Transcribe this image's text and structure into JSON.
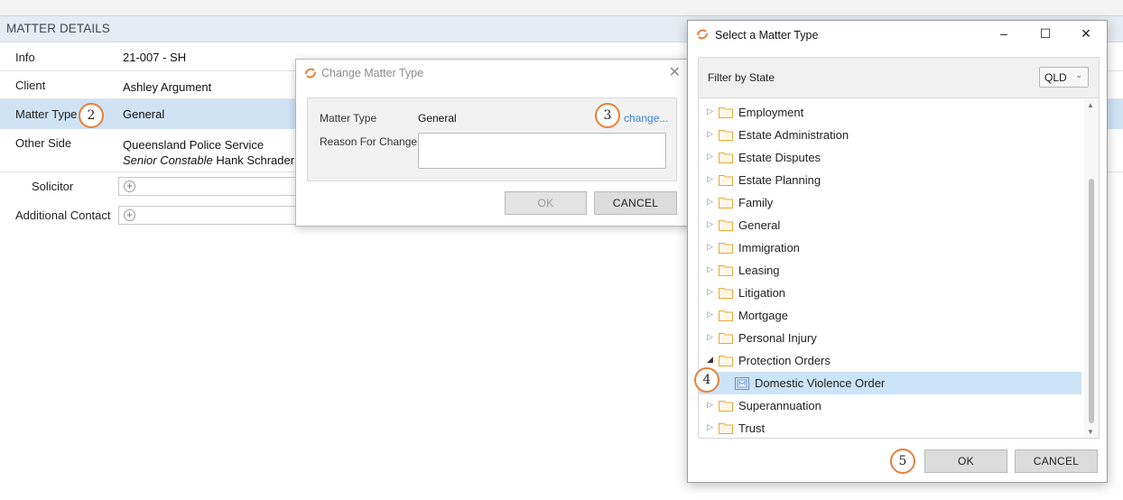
{
  "page": {
    "section_title": "MATTER DETAILS",
    "rows": {
      "info": {
        "label": "Info",
        "value": "21-007 - SH"
      },
      "client": {
        "label": "Client",
        "value": "Ashley Argument"
      },
      "matter_type": {
        "label": "Matter Type",
        "value": "General"
      },
      "other_side": {
        "label": "Other Side",
        "value": "Queensland Police Service",
        "contact_role": "Senior Constable",
        "contact_name": "Hank Schrader"
      },
      "solicitor": {
        "label": "Solicitor"
      },
      "additional_contact": {
        "label": "Additional Contact"
      }
    }
  },
  "change_dialog": {
    "title": "Change Matter Type",
    "matter_type_label": "Matter Type",
    "matter_type_value": "General",
    "change_link": "change...",
    "reason_label": "Reason For Change",
    "reason_value": "",
    "ok_label": "OK",
    "cancel_label": "CANCEL"
  },
  "select_dialog": {
    "title": "Select a Matter Type",
    "filter_label": "Filter by State",
    "state_value": "QLD",
    "tree": [
      {
        "label": "Employment",
        "expanded": false
      },
      {
        "label": "Estate Administration",
        "expanded": false
      },
      {
        "label": "Estate Disputes",
        "expanded": false
      },
      {
        "label": "Estate Planning",
        "expanded": false
      },
      {
        "label": "Family",
        "expanded": false
      },
      {
        "label": "General",
        "expanded": false
      },
      {
        "label": "Immigration",
        "expanded": false
      },
      {
        "label": "Leasing",
        "expanded": false
      },
      {
        "label": "Litigation",
        "expanded": false
      },
      {
        "label": "Mortgage",
        "expanded": false
      },
      {
        "label": "Personal Injury",
        "expanded": false
      },
      {
        "label": "Protection Orders",
        "expanded": true
      },
      {
        "label": "Domestic Violence Order",
        "child": true,
        "selected": true
      },
      {
        "label": "Superannuation",
        "expanded": false
      },
      {
        "label": "Trust",
        "expanded": false
      }
    ],
    "ok_label": "OK",
    "cancel_label": "CANCEL"
  },
  "callouts": [
    "2",
    "3",
    "4",
    "5"
  ],
  "colors": {
    "accent_orange": "#e8803a",
    "selection_blue": "#cce4f7",
    "row_highlight": "#cfe3f5",
    "link_blue": "#3b7fd1",
    "folder_yellow": "#e8a93a"
  }
}
